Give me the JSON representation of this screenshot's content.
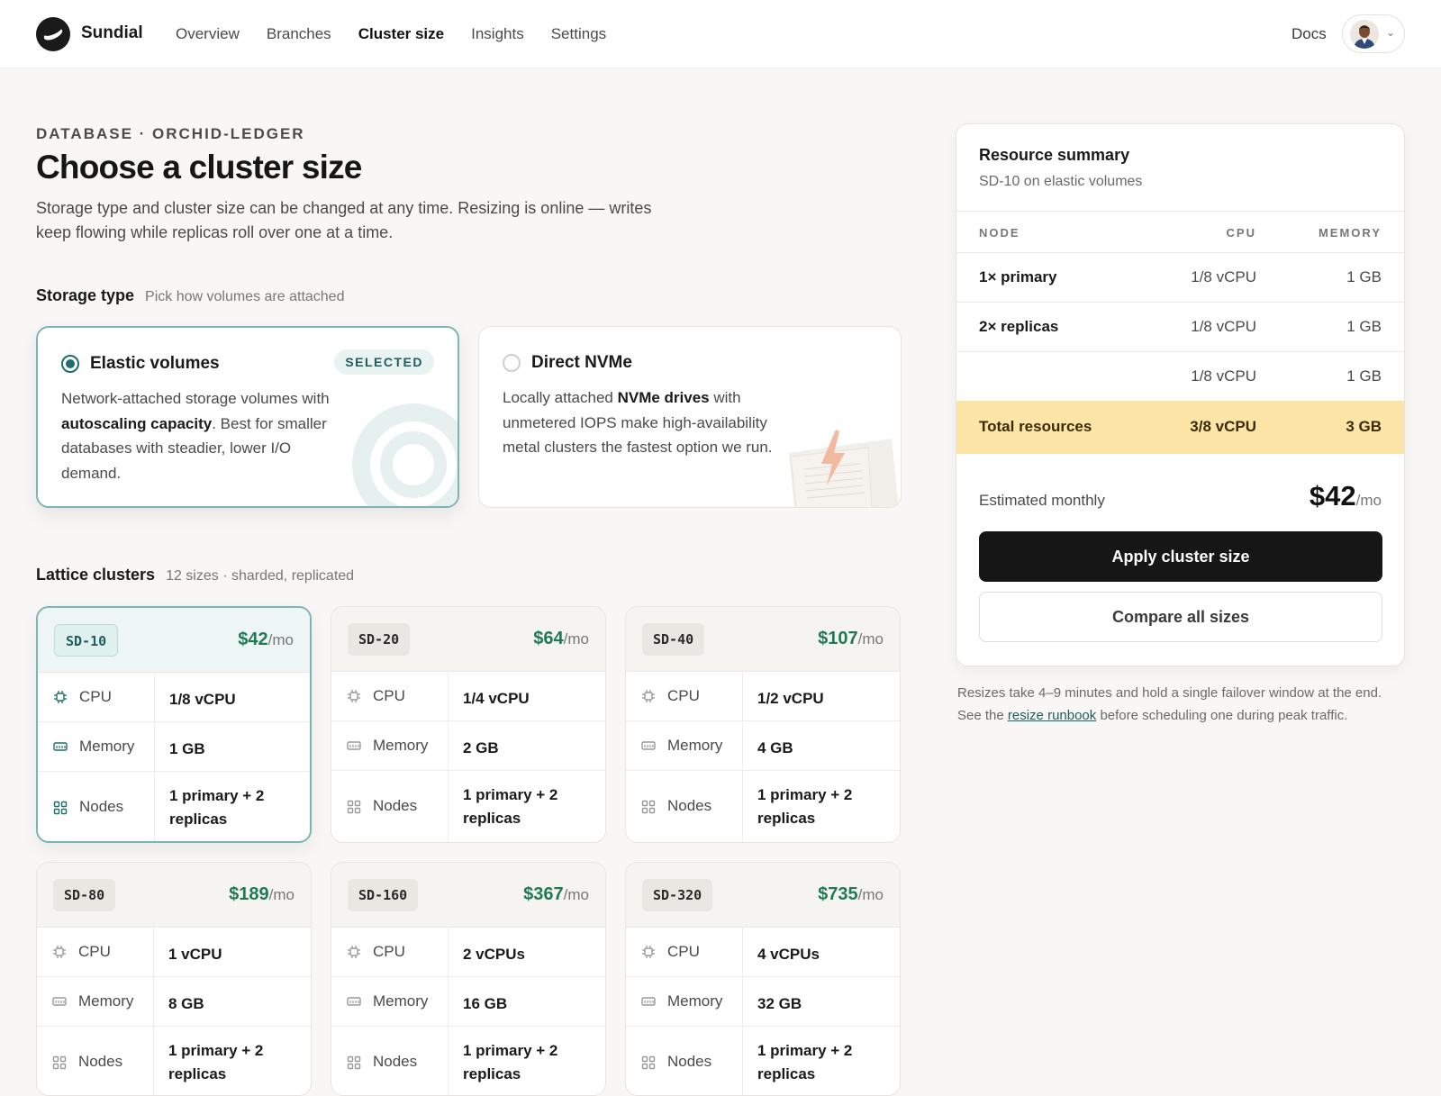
{
  "app": {
    "brand": "Sundial"
  },
  "nav": {
    "items": [
      "Overview",
      "Branches",
      "Cluster size",
      "Insights",
      "Settings"
    ],
    "active": "Cluster size",
    "docs": "Docs"
  },
  "page": {
    "eyebrow": "DATABASE · ORCHID-LEDGER",
    "title": "Choose a cluster size",
    "subtitle": "Storage type and cluster size can be changed at any time. Resizing is online — writes keep flowing while replicas roll over one at a time."
  },
  "storage": {
    "heading": "Storage type",
    "hint": "Pick how volumes are attached",
    "options": [
      {
        "title": "Elastic volumes",
        "badge": "SELECTED",
        "selected": true,
        "desc_pre": "Network-attached storage volumes with ",
        "desc_bold": "autoscaling capacity",
        "desc_post": ". Best for smaller databases with steadier, lower I/O demand."
      },
      {
        "title": "Direct NVMe",
        "selected": false,
        "desc_pre": "Locally attached ",
        "desc_bold": "NVMe drives",
        "desc_post": " with unmetered IOPS make high-availability metal clusters the fastest option we run."
      }
    ]
  },
  "clusters": {
    "heading": "Lattice clusters",
    "hint": "12 sizes · sharded, replicated",
    "unit": "/mo",
    "labels": {
      "cpu": "CPU",
      "memory": "Memory",
      "nodes": "Nodes"
    },
    "plans": [
      {
        "code": "SD-10",
        "price": "$42",
        "cpu": "1/8 vCPU",
        "memory": "1 GB",
        "nodes": "1 primary + 2 replicas",
        "selected": true
      },
      {
        "code": "SD-20",
        "price": "$64",
        "cpu": "1/4 vCPU",
        "memory": "2 GB",
        "nodes": "1 primary + 2 replicas"
      },
      {
        "code": "SD-40",
        "price": "$107",
        "cpu": "1/2 vCPU",
        "memory": "4 GB",
        "nodes": "1 primary + 2 replicas"
      },
      {
        "code": "SD-80",
        "price": "$189",
        "cpu": "1 vCPU",
        "memory": "8 GB",
        "nodes": "1 primary + 2 replicas"
      },
      {
        "code": "SD-160",
        "price": "$367",
        "cpu": "2 vCPUs",
        "memory": "16 GB",
        "nodes": "1 primary + 2 replicas"
      },
      {
        "code": "SD-320",
        "price": "$735",
        "cpu": "4 vCPUs",
        "memory": "32 GB",
        "nodes": "1 primary + 2 replicas"
      }
    ]
  },
  "summary": {
    "title": "Resource summary",
    "subtitle": "SD-10 on elastic volumes",
    "columns": [
      "NODE",
      "CPU",
      "MEMORY"
    ],
    "rows": [
      {
        "node": "1× primary",
        "cpu": "1/8 vCPU",
        "memory": "1 GB"
      },
      {
        "node": "2× replicas",
        "cpu": "1/8 vCPU",
        "memory": "1 GB"
      },
      {
        "node": "",
        "cpu": "1/8 vCPU",
        "memory": "1 GB"
      }
    ],
    "total": {
      "label": "Total resources",
      "cpu": "3/8 vCPU",
      "memory": "3 GB"
    },
    "estimate_label": "Estimated monthly",
    "estimate_value": "$42",
    "estimate_unit": "/mo",
    "apply_label": "Apply cluster size",
    "compare_label": "Compare all sizes"
  },
  "note": {
    "pre": "Resizes take 4–9 minutes and hold a single failover window at the end. See the ",
    "link": "resize runbook",
    "post": " before scheduling one during peak traffic."
  },
  "colors": {
    "accent": "#1f6e6e",
    "price": "#1f7a52",
    "total_bg": "#fde5a8",
    "primary_button": "#161616"
  }
}
